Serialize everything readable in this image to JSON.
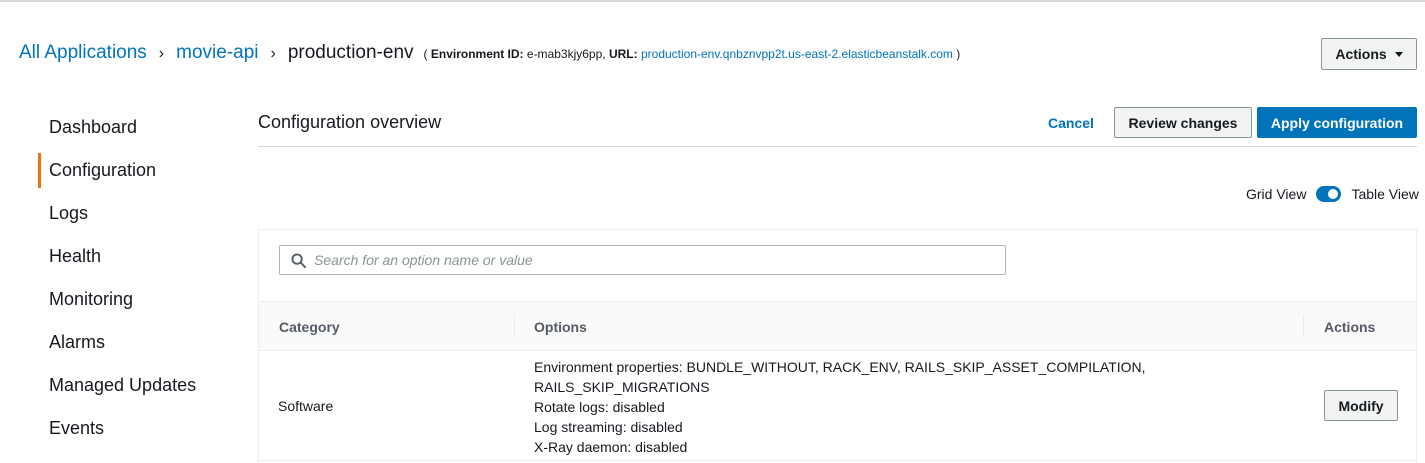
{
  "breadcrumb": {
    "items": [
      "All Applications",
      "movie-api"
    ],
    "current": "production-env",
    "env_id_label": "Environment ID:",
    "env_id": "e-mab3kjy6pp,",
    "url_label": "URL:",
    "url": "production-env.qnbznvpp2t.us-east-2.elasticbeanstalk.com",
    "open_paren": "(",
    "close_paren": ")"
  },
  "actions_button": {
    "label": "Actions"
  },
  "sidebar": {
    "items": [
      {
        "label": "Dashboard"
      },
      {
        "label": "Configuration"
      },
      {
        "label": "Logs"
      },
      {
        "label": "Health"
      },
      {
        "label": "Monitoring"
      },
      {
        "label": "Alarms"
      },
      {
        "label": "Managed Updates"
      },
      {
        "label": "Events"
      }
    ],
    "active": "Configuration"
  },
  "header": {
    "title": "Configuration overview",
    "cancel_label": "Cancel",
    "review_label": "Review changes",
    "apply_label": "Apply configuration"
  },
  "view_toggle": {
    "left_label": "Grid View",
    "right_label": "Table View",
    "state": "on"
  },
  "search": {
    "placeholder": "Search for an option name or value",
    "value": ""
  },
  "table": {
    "columns": [
      "Category",
      "Options",
      "Actions"
    ],
    "rows": [
      {
        "category": "Software",
        "options": [
          "Environment properties: BUNDLE_WITHOUT, RACK_ENV, RAILS_SKIP_ASSET_COMPILATION,",
          "RAILS_SKIP_MIGRATIONS",
          "Rotate logs: disabled",
          "Log streaming: disabled",
          "X-Ray daemon: disabled"
        ],
        "action_label": "Modify"
      }
    ]
  },
  "colors": {
    "link": "#0073bb",
    "primary_button": "#0073bb",
    "active_nav_indicator": "#ec7211"
  }
}
